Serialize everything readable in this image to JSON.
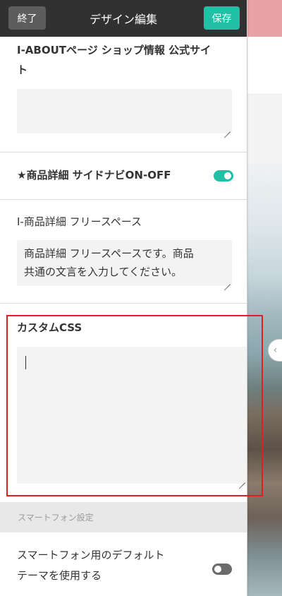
{
  "topbar": {
    "exit_label": "終了",
    "title": "デザイン編集",
    "save_label": "保存"
  },
  "sections": {
    "about_page": {
      "label_line1": "I-ABOUTページ ショップ情報 公式サイ",
      "label_line2": "ト",
      "value": ""
    },
    "side_nav": {
      "label": "★商品詳細 サイドナビON-OFF",
      "toggle_on": true
    },
    "free_space": {
      "label": "I-商品詳細 フリースペース",
      "value_line1": "商品詳細 フリースペースです。商品",
      "value_line2": "共通の文言を入力してください。"
    },
    "custom_css": {
      "label": "カスタムCSS",
      "value": ""
    },
    "smartphone_group": {
      "header": "スマートフォン設定",
      "default_theme_line1": "スマートフォン用のデフォルト",
      "default_theme_line2": "テーマを使用する",
      "toggle_on": false
    }
  },
  "colors": {
    "topbar_bg": "#313131",
    "save_button": "#21bfa5",
    "toggle_on": "#21bfa5",
    "toggle_off": "#6b6b6b",
    "highlight": "#e02020",
    "preview_header": "#e9a3a6"
  },
  "icons": {
    "preview_nav": "chevron-left-icon"
  }
}
